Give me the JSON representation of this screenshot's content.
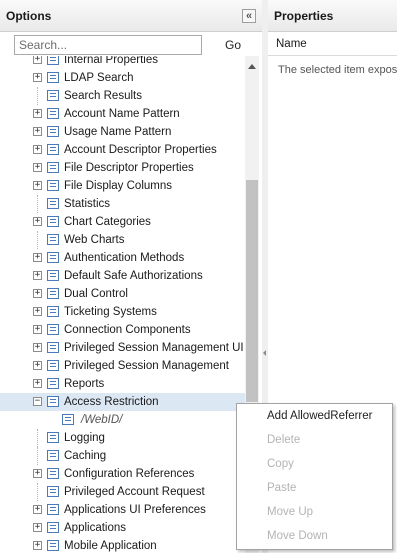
{
  "options": {
    "title": "Options",
    "collapse": "«",
    "search_placeholder": "Search...",
    "go": "Go",
    "tree": [
      {
        "label": "Internal Properties",
        "expandable": true
      },
      {
        "label": "LDAP Search",
        "expandable": true
      },
      {
        "label": "Search Results",
        "expandable": false
      },
      {
        "label": "Account Name Pattern",
        "expandable": true
      },
      {
        "label": "Usage Name Pattern",
        "expandable": true
      },
      {
        "label": "Account Descriptor Properties",
        "expandable": true
      },
      {
        "label": "File Descriptor Properties",
        "expandable": true
      },
      {
        "label": "File Display Columns",
        "expandable": true
      },
      {
        "label": "Statistics",
        "expandable": false
      },
      {
        "label": "Chart Categories",
        "expandable": true
      },
      {
        "label": "Web Charts",
        "expandable": false
      },
      {
        "label": "Authentication Methods",
        "expandable": true
      },
      {
        "label": "Default Safe Authorizations",
        "expandable": true
      },
      {
        "label": "Dual Control",
        "expandable": true
      },
      {
        "label": "Ticketing Systems",
        "expandable": true
      },
      {
        "label": "Connection Components",
        "expandable": true
      },
      {
        "label": "Privileged Session Management UI",
        "expandable": true
      },
      {
        "label": "Privileged Session Management",
        "expandable": true
      },
      {
        "label": "Reports",
        "expandable": true
      },
      {
        "label": "Access Restriction",
        "expandable": true,
        "expanded": true,
        "selected": true
      },
      {
        "label": "/WebID/",
        "child": true
      },
      {
        "label": "Logging",
        "expandable": false
      },
      {
        "label": "Caching",
        "expandable": false
      },
      {
        "label": "Configuration References",
        "expandable": true
      },
      {
        "label": "Privileged Account Request",
        "expandable": false
      },
      {
        "label": "Applications UI Preferences",
        "expandable": true
      },
      {
        "label": "Applications",
        "expandable": true
      },
      {
        "label": "Mobile Application",
        "expandable": true
      }
    ]
  },
  "properties": {
    "title": "Properties",
    "column": "Name",
    "message": "The selected item exposes"
  },
  "context_menu": [
    {
      "label": "Add AllowedReferrer",
      "enabled": true
    },
    {
      "label": "Delete",
      "enabled": false
    },
    {
      "label": "Copy",
      "enabled": false
    },
    {
      "label": "Paste",
      "enabled": false
    },
    {
      "label": "Move Up",
      "enabled": false
    },
    {
      "label": "Move Down",
      "enabled": false
    }
  ]
}
